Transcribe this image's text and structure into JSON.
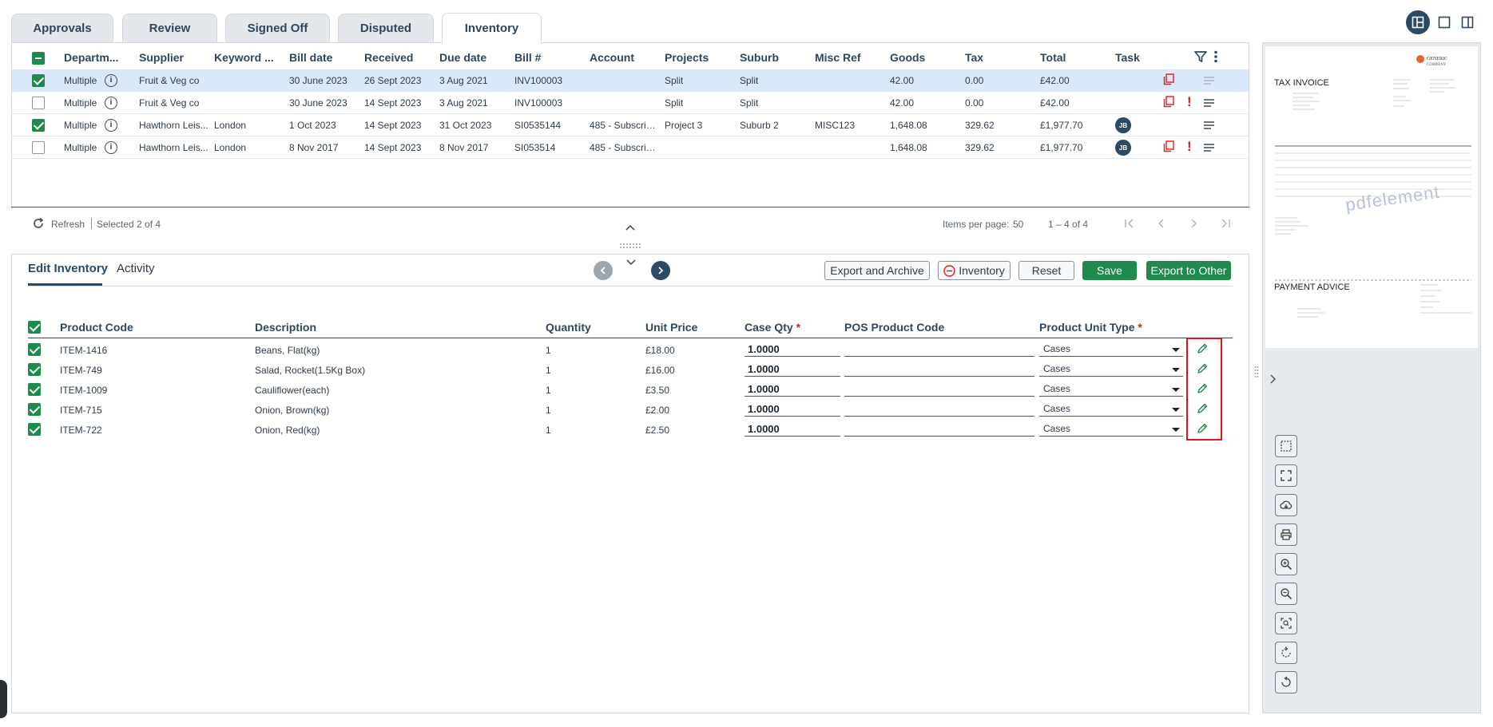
{
  "tabs": [
    {
      "label": "Approvals"
    },
    {
      "label": "Review"
    },
    {
      "label": "Signed Off"
    },
    {
      "label": "Disputed"
    },
    {
      "label": "Inventory",
      "active": true
    }
  ],
  "grid": {
    "headers": [
      "Departm...",
      "Supplier",
      "Keyword ...",
      "Bill date",
      "Received",
      "Due date",
      "Bill #",
      "Account",
      "Projects",
      "Suburb",
      "Misc Ref",
      "Goods",
      "Tax",
      "Total",
      "Task"
    ],
    "rows": [
      {
        "checked": true,
        "department": "Multiple",
        "supplier": "Fruit & Veg co",
        "keyword": "",
        "bill_date": "30 June 2023",
        "received": "26 Sept 2023",
        "due_date": "3 Aug 2021",
        "bill_no": "INV100003",
        "account": "",
        "projects": "Split",
        "suburb": "Split",
        "misc_ref": "",
        "goods": "42.00",
        "tax": "0.00",
        "total": "£42.00",
        "task": "",
        "copy": true,
        "alert": false
      },
      {
        "checked": false,
        "department": "Multiple",
        "supplier": "Fruit & Veg co",
        "keyword": "",
        "bill_date": "30 June 2023",
        "received": "14 Sept 2023",
        "due_date": "3 Aug 2021",
        "bill_no": "INV100003",
        "account": "",
        "projects": "Split",
        "suburb": "Split",
        "misc_ref": "",
        "goods": "42.00",
        "tax": "0.00",
        "total": "£42.00",
        "task": "",
        "copy": true,
        "alert": true
      },
      {
        "checked": true,
        "department": "Multiple",
        "supplier": "Hawthorn Leis...",
        "keyword": "London",
        "bill_date": "1 Oct 2023",
        "received": "14 Sept 2023",
        "due_date": "31 Oct 2023",
        "bill_no": "SI0535144",
        "account": "485 - Subscript...",
        "projects": "Project 3",
        "suburb": "Suburb 2",
        "misc_ref": "MISC123",
        "goods": "1,648.08",
        "tax": "329.62",
        "total": "£1,977.70",
        "task": "JB",
        "copy": false,
        "alert": false
      },
      {
        "checked": false,
        "department": "Multiple",
        "supplier": "Hawthorn Leis...",
        "keyword": "London",
        "bill_date": "8 Nov 2017",
        "received": "14 Sept 2023",
        "due_date": "8 Nov 2017",
        "bill_no": "SI053514",
        "account": "485 - Subscript...",
        "projects": "",
        "suburb": "",
        "misc_ref": "",
        "goods": "1,648.08",
        "tax": "329.62",
        "total": "£1,977.70",
        "task": "JB",
        "copy": true,
        "alert": true
      }
    ],
    "footer": {
      "refresh": "Refresh",
      "selected": "Selected 2 of 4",
      "items_per_page_label": "Items per page:",
      "items_per_page": "50",
      "range": "1 – 4 of 4"
    }
  },
  "editor": {
    "tabs": [
      {
        "label": "Edit Inventory",
        "active": true
      },
      {
        "label": "Activity"
      }
    ],
    "buttons": {
      "export_archive": "Export and Archive",
      "inventory": "Inventory",
      "reset": "Reset",
      "save": "Save",
      "export_other": "Export to Other"
    },
    "headers": {
      "product_code": "Product Code",
      "description": "Description",
      "quantity": "Quantity",
      "unit_price": "Unit Price",
      "case_qty": "Case Qty",
      "pos_code": "POS Product Code",
      "unit_type": "Product Unit Type",
      "required_mark": "*"
    },
    "rows": [
      {
        "code": "ITEM-1416",
        "description": "Beans, Flat(kg)",
        "quantity": "1",
        "unit_price": "£18.00",
        "case_qty": "1.0000",
        "pos_code": "",
        "unit_type": "Cases"
      },
      {
        "code": "ITEM-749",
        "description": "Salad, Rocket(1.5Kg Box)",
        "quantity": "1",
        "unit_price": "£16.00",
        "case_qty": "1.0000",
        "pos_code": "",
        "unit_type": "Cases"
      },
      {
        "code": "ITEM-1009",
        "description": "Cauliflower(each)",
        "quantity": "1",
        "unit_price": "£3.50",
        "case_qty": "1.0000",
        "pos_code": "",
        "unit_type": "Cases"
      },
      {
        "code": "ITEM-715",
        "description": "Onion, Brown(kg)",
        "quantity": "1",
        "unit_price": "£2.00",
        "case_qty": "1.0000",
        "pos_code": "",
        "unit_type": "Cases"
      },
      {
        "code": "ITEM-722",
        "description": "Onion, Red(kg)",
        "quantity": "1",
        "unit_price": "£2.50",
        "case_qty": "1.0000",
        "pos_code": "",
        "unit_type": "Cases"
      }
    ]
  },
  "preview": {
    "doc_title": "TAX INVOICE",
    "doc_section": "PAYMENT ADVICE",
    "company_logo": "GENERIC COMPANY",
    "watermark": "pdfelement"
  },
  "colors": {
    "accent_green": "#1e8a4c",
    "navy": "#2b4a66",
    "selected_row": "#dbe7fb",
    "alert_red": "#e01b1b",
    "highlight_box": "#e0141e"
  }
}
